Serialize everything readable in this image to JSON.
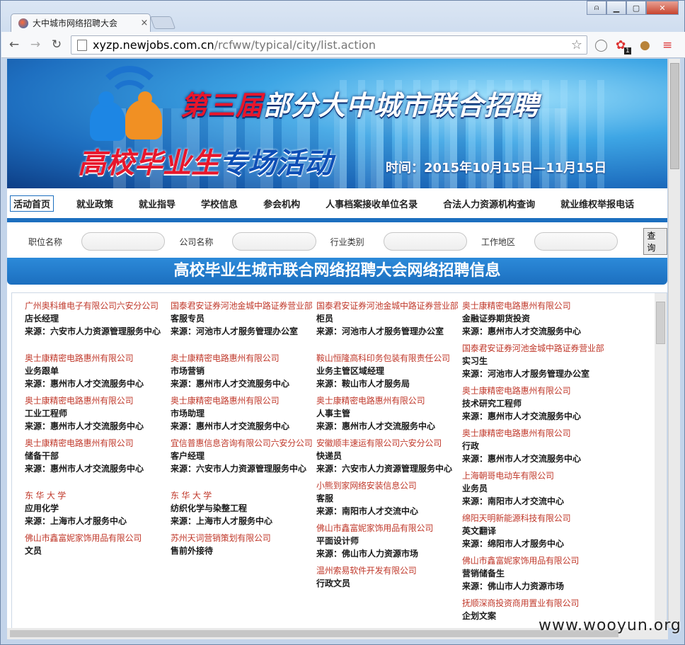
{
  "browser": {
    "tab_title": "大中城市网络招聘大会",
    "url_host": "xyzp.newjobs.com.cn",
    "url_path": "/rcfww/typical/city/list.action",
    "controls": {
      "user": "⍝",
      "min": "▁",
      "max": "▢",
      "close": "✕"
    },
    "ext_badge": "1"
  },
  "banner": {
    "title_red": "第三届",
    "title_rest": "部分大中城市联合招聘",
    "subtitle_red": "高校毕业生",
    "subtitle_blue": "专场活动",
    "time": "时间：2015年10月15日—11月15日"
  },
  "nav": [
    "活动首页",
    "就业政策",
    "就业指导",
    "学校信息",
    "参会机构",
    "人事档案接收单位名录",
    "合法人力资源机构查询",
    "就业维权举报电话"
  ],
  "search": {
    "job_label": "职位名称",
    "company_label": "公司名称",
    "industry_label": "行业类别",
    "area_label": "工作地区",
    "button": "查询"
  },
  "heading": "高校毕业生城市联合网络招聘大会网络招聘信息",
  "columns": [
    [
      {
        "company": "广州奥科维电子有限公司六安分公司",
        "job": "店长经理",
        "source": "来源：六安市人力资源管理服务中心"
      },
      {
        "company": "奥士康精密电路惠州有限公司",
        "job": "业务跟单",
        "source": "来源：惠州市人才交流服务中心",
        "gap": true
      },
      {
        "company": "奥士康精密电路惠州有限公司",
        "job": "工业工程师",
        "source": "来源：惠州市人才交流服务中心"
      },
      {
        "company": "奥士康精密电路惠州有限公司",
        "job": "储备干部",
        "source": "来源：惠州市人才交流服务中心"
      },
      {
        "company": "东 华 大 学",
        "job": "应用化学",
        "source": "来源：上海市人才服务中心",
        "gap": true
      },
      {
        "company": "佛山市鑫富妮家饰用品有限公司",
        "job": "文员",
        "source": ""
      }
    ],
    [
      {
        "company": "国泰君安证券河池金城中路证券营业部",
        "job": "客服专员",
        "source": "来源：河池市人才服务管理办公室"
      },
      {
        "company": "奥士康精密电路惠州有限公司",
        "job": "市场营销",
        "source": "来源：惠州市人才交流服务中心",
        "gap": true
      },
      {
        "company": "奥士康精密电路惠州有限公司",
        "job": "市场助理",
        "source": "来源：惠州市人才交流服务中心"
      },
      {
        "company": "宜信普惠信息咨询有限公司六安分公司",
        "job": "客户经理",
        "source": "来源：六安市人力资源管理服务中心"
      },
      {
        "company": "东 华 大 学",
        "job": "纺织化学与染整工程",
        "source": "来源：上海市人才服务中心",
        "gap": true
      },
      {
        "company": "苏州天词营销策划有限公司",
        "job": "售前外接待",
        "source": ""
      }
    ],
    [
      {
        "company": "国泰君安证券河池金城中路证券营业部",
        "job": "柜员",
        "source": "来源：河池市人才服务管理办公室"
      },
      {
        "company": "鞍山恒隆高科印务包装有限责任公司",
        "job": "业务主管区域经理",
        "source": "来源：鞍山市人才服务局",
        "gap": true
      },
      {
        "company": "奥士康精密电路惠州有限公司",
        "job": "人事主管",
        "source": "来源：惠州市人才交流服务中心"
      },
      {
        "company": "安徽顺丰速运有限公司六安分公司",
        "job": "快递员",
        "source": "来源：六安市人力资源管理服务中心"
      },
      {
        "company": "小熊到家网络安装信息公司",
        "job": "客服",
        "source": "来源：南阳市人才交流中心"
      },
      {
        "company": "佛山市鑫富妮家饰用品有限公司",
        "job": "平面设计师",
        "source": "来源：佛山市人力资源市场"
      },
      {
        "company": "温州索易软件开发有限公司",
        "job": "行政文员",
        "source": ""
      }
    ],
    [
      {
        "company": "奥士康精密电路惠州有限公司",
        "job": "金融证券期货投资",
        "source": "来源：惠州市人才交流服务中心"
      },
      {
        "company": "国泰君安证券河池金城中路证券营业部",
        "job": "实习生",
        "source": "来源：河池市人才服务管理办公室"
      },
      {
        "company": "奥士康精密电路惠州有限公司",
        "job": "技术研究工程师",
        "source": "来源：惠州市人才交流服务中心"
      },
      {
        "company": "奥士康精密电路惠州有限公司",
        "job": "行政",
        "source": "来源：惠州市人才交流服务中心"
      },
      {
        "company": "上海朝哥电动车有限公司",
        "job": "业务员",
        "source": "来源：南阳市人才交流中心"
      },
      {
        "company": "绵阳天明新能源科技有限公司",
        "job": "英文翻译",
        "source": "来源：绵阳市人才服务中心"
      },
      {
        "company": "佛山市鑫富妮家饰用品有限公司",
        "job": "营销储备生",
        "source": "来源：佛山市人力资源市场"
      },
      {
        "company": "抚顺深商投资商用置业有限公司",
        "job": "企划文案",
        "source": ""
      }
    ]
  ],
  "watermark": "www.wooyun.org"
}
